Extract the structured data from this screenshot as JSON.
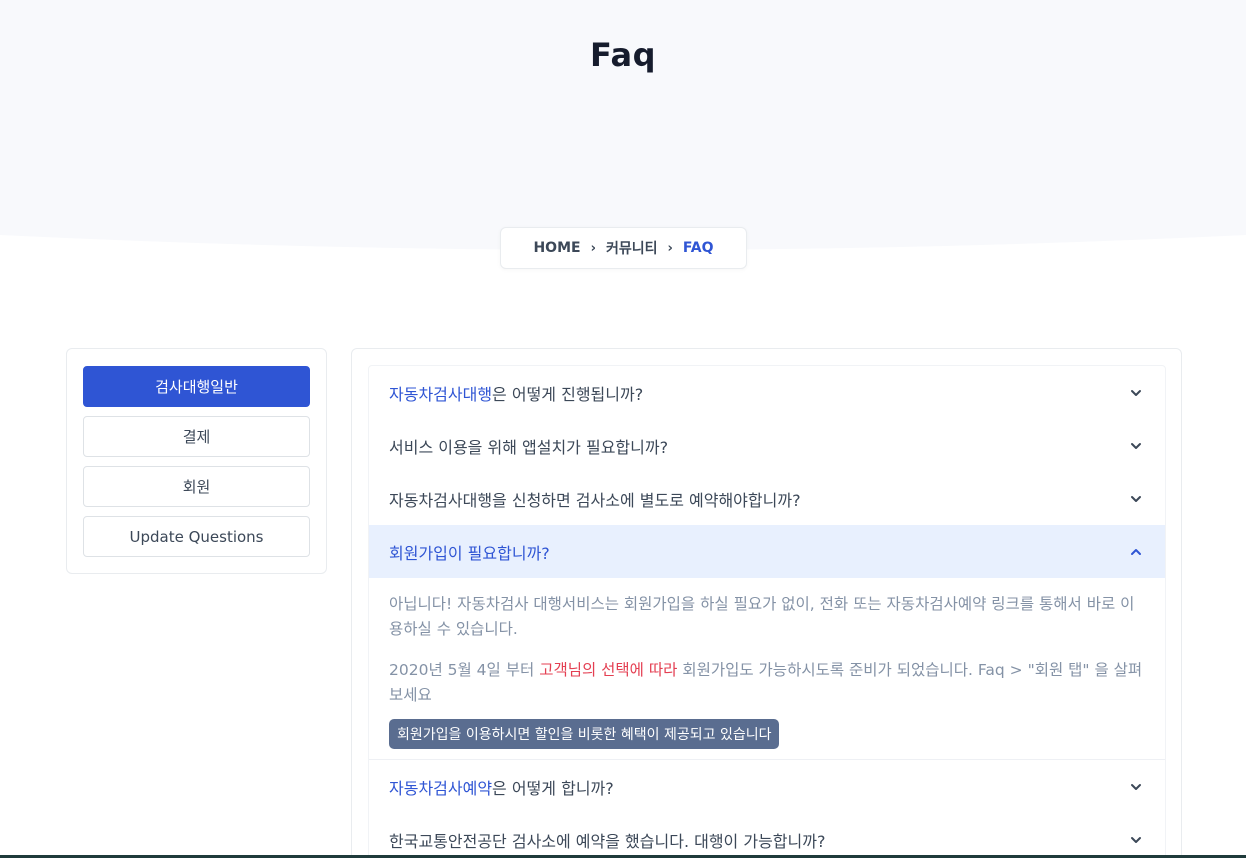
{
  "header": {
    "title": "Faq"
  },
  "breadcrumb": {
    "home": "HOME",
    "community": "커뮤니티",
    "current": "FAQ",
    "separator": "›"
  },
  "sidebar": {
    "items": [
      {
        "label": "검사대행일반",
        "active": true
      },
      {
        "label": "결제",
        "active": false
      },
      {
        "label": "회원",
        "active": false
      },
      {
        "label": "Update Questions",
        "active": false
      }
    ]
  },
  "faq": {
    "q1": {
      "highlight": "자동차검사대행",
      "rest": "은 어떻게 진행됩니까?"
    },
    "q2": {
      "text": "서비스 이용을 위해 앱설치가 필요합니까?"
    },
    "q3": {
      "text": "자동차검사대행을 신청하면 검사소에 별도로 예약해야합니까?"
    },
    "q4": {
      "text": "회원가입이 필요합니까?"
    },
    "answer": {
      "p1": "아닙니다! 자동차검사 대행서비스는 회원가입을 하실 필요가 없이, 전화 또는 자동차검사예약 링크를 통해서 바로 이용하실 수 있습니다.",
      "p2_before": "2020년 5월 4일 부터 ",
      "p2_red": "고객님의 선택에 따라",
      "p2_after": " 회원가입도 가능하시도록 준비가 되었습니다. Faq > \"회원 탭\" 을 살펴보세요",
      "badge": "회원가입을 이용하시면 할인을 비롯한 혜택이 제공되고 있습니다"
    },
    "q5": {
      "highlight": "자동차검사예약",
      "rest": "은 어떻게 합니까?"
    },
    "q6": {
      "text": "한국교통안전공단 검사소에 예약을 했습니다. 대행이 가능합니까?"
    }
  },
  "colors": {
    "primary": "#2f55d4",
    "muted": "#8492a6",
    "danger": "#e43f52",
    "badge": "#5a6d90"
  }
}
